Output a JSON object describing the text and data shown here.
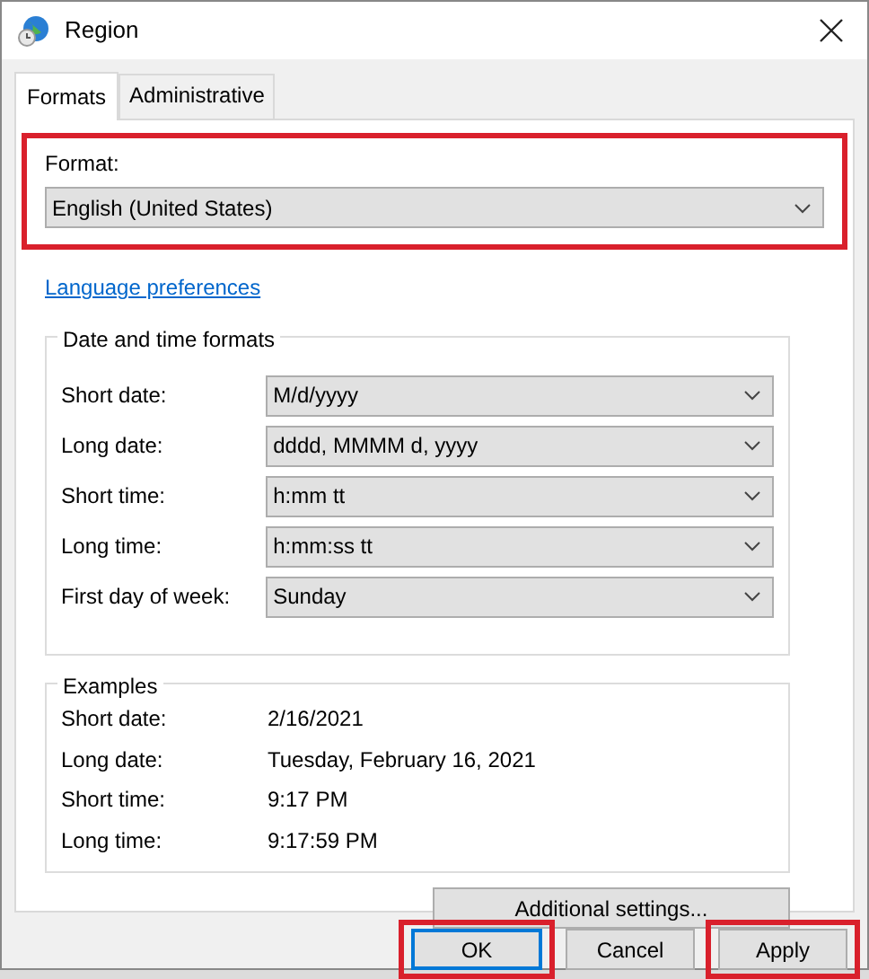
{
  "window": {
    "title": "Region"
  },
  "tabs": [
    {
      "label": "Formats",
      "selected": true
    },
    {
      "label": "Administrative",
      "selected": false
    }
  ],
  "format": {
    "label": "Format:",
    "value": "English (United States)",
    "highlighted": true
  },
  "language_link": "Language preferences",
  "date_time_formats": {
    "title": "Date and time formats",
    "rows": [
      {
        "label": "Short date:",
        "value": "M/d/yyyy"
      },
      {
        "label": "Long date:",
        "value": "dddd, MMMM d, yyyy"
      },
      {
        "label": "Short time:",
        "value": "h:mm tt"
      },
      {
        "label": "Long time:",
        "value": "h:mm:ss tt"
      },
      {
        "label": "First day of week:",
        "value": "Sunday"
      }
    ]
  },
  "examples": {
    "title": "Examples",
    "rows": [
      {
        "label": "Short date:",
        "value": "2/16/2021"
      },
      {
        "label": "Long date:",
        "value": "Tuesday, February 16, 2021"
      },
      {
        "label": "Short time:",
        "value": "9:17 PM"
      },
      {
        "label": "Long time:",
        "value": "9:17:59 PM"
      }
    ]
  },
  "additional_button": "Additional settings...",
  "buttons": [
    {
      "label": "OK",
      "default": true,
      "highlighted": true
    },
    {
      "label": "Cancel",
      "default": false,
      "highlighted": false
    },
    {
      "label": "Apply",
      "default": false,
      "highlighted": true
    }
  ]
}
